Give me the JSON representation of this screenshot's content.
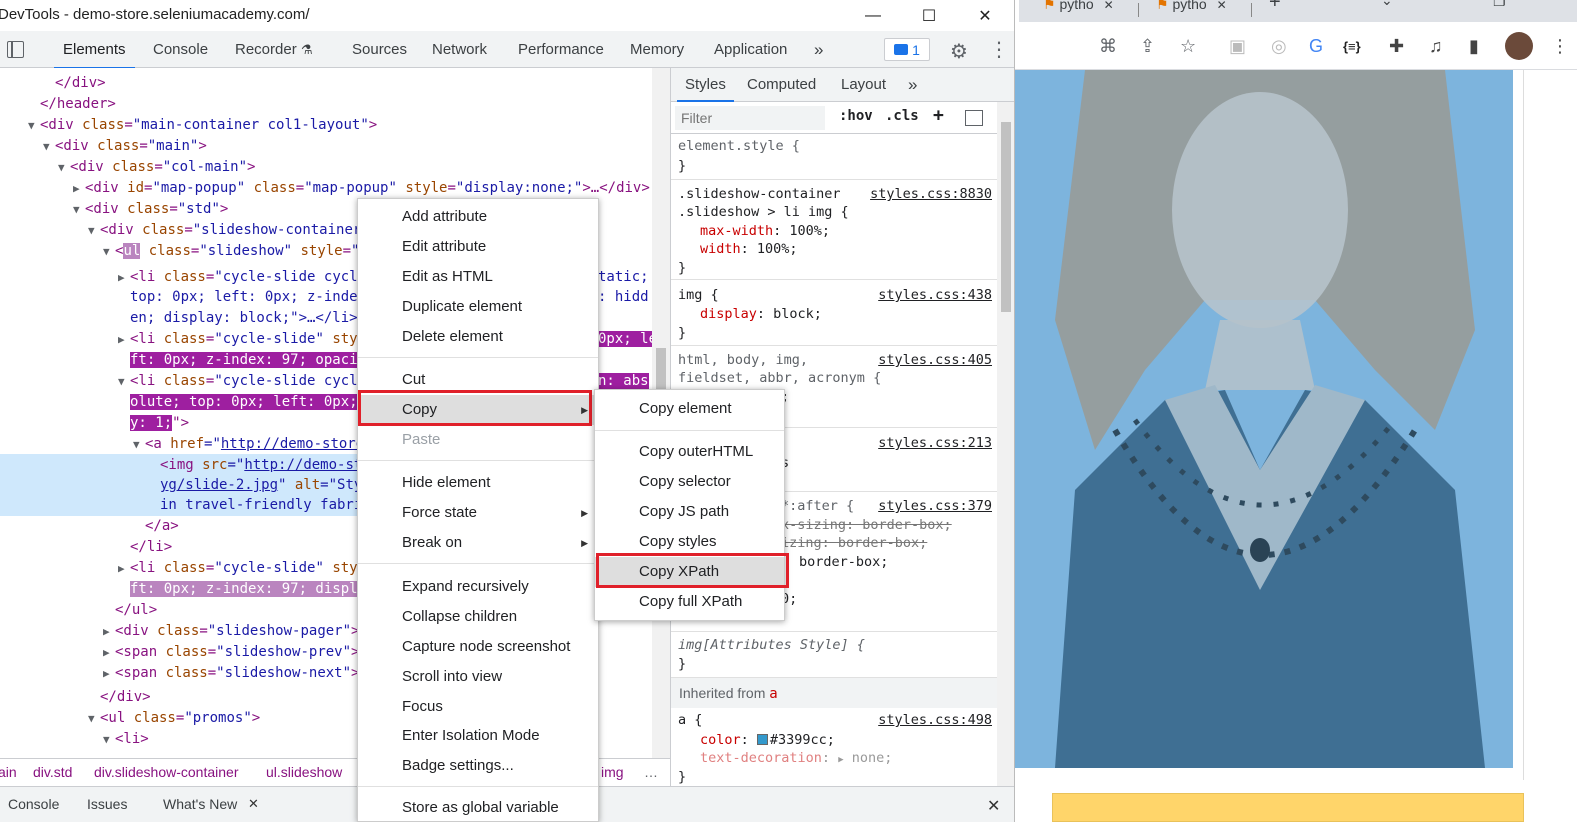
{
  "titlebar": {
    "title": "DevTools - demo-store.seleniumacademy.com/",
    "minimize": "—",
    "maximize": "☐",
    "close": "✕"
  },
  "devtools_tabs": [
    "Elements",
    "Console",
    "Recorder",
    "Sources",
    "Network",
    "Performance",
    "Memory",
    "Application",
    "»"
  ],
  "recorder_glyph": "⚗",
  "issues_count": "1",
  "icons": {
    "settings": "⚙",
    "more": "⋮"
  },
  "dom": {
    "l0": "</div>",
    "l1": "</header>",
    "l2": {
      "tag": "<div ",
      "an": "class",
      "av": "\"main-container col1-layout\"",
      "end": ">"
    },
    "l3": {
      "tag": "<div ",
      "an": "class",
      "av": "\"main\"",
      "end": ">"
    },
    "l4": {
      "tag": "<div ",
      "an": "class",
      "av": "\"col-main\"",
      "end": ">"
    },
    "l5": {
      "tag": "<div ",
      "an": "id",
      "av": "\"map-popup\"",
      "an2": " class",
      "av2": "\"map-popup\"",
      "an3": " style",
      "av3": "\"display:none;\"",
      "end": ">…</div>"
    },
    "l6": {
      "tag": "<div ",
      "an": "class",
      "av": "\"std\"",
      "end": ">"
    },
    "l7": {
      "tag": "<div ",
      "an": "class",
      "av": "\"slideshow-container"
    },
    "l8": {
      "pre": "<",
      "tagname": "ul",
      "an": " class",
      "av": "\"slideshow\"",
      "an2": " style",
      "av2": "\""
    },
    "l9a": {
      "tag": "<li ",
      "an": "class",
      "av": "\"cycle-slide cycle",
      "tail": "tatic;"
    },
    "l9b": {
      "text": "top: 0px; left: 0px; z-index",
      "tail": ": hidd"
    },
    "l9c": {
      "text": "en; display: block;\">…</li>"
    },
    "l10a": {
      "tag": "<li ",
      "an": "class",
      "av": "\"cycle-slide\"",
      "an2": " sty",
      "tail": "0px; le"
    },
    "l10b": {
      "text": "ft: 0px; z-index: 97; opacit"
    },
    "l11a": {
      "tag": "<li ",
      "an": "class",
      "av": "\"cycle-slide cycle",
      "tail": "n: abs"
    },
    "l11b": {
      "text": "olute; top: 0px; left: 0px;"
    },
    "l11c": {
      "text": "y: 1;",
      "end": "\">"
    },
    "l12": {
      "tag": "<a ",
      "an": "href",
      "eq": "=\"",
      "link": "http://demo-store"
    },
    "l13": {
      "tag": "<img ",
      "an": "src",
      "eq": "=\"",
      "link": "http://demo-st"
    },
    "l13b": {
      "link": "yg/slide-2.jpg",
      "rest": "\" ",
      "an": "alt",
      "av": "=\"Sty"
    },
    "l13c": {
      "text": "in travel-friendly fabri"
    },
    "l14": "</a>",
    "l15": "</li>",
    "l16a": {
      "tag": "<li ",
      "an": "class",
      "av": "\"cycle-slide\"",
      "an2": " styl"
    },
    "l16b": {
      "text": "ft: 0px; z-index: 97; displa"
    },
    "l17": "</ul>",
    "l18": {
      "tag": "<div ",
      "an": "class",
      "av": "\"slideshow-pager\"",
      "end": ">…"
    },
    "l19": {
      "tag": "<span ",
      "an": "class",
      "av": "\"slideshow-prev\"",
      "end": ">…"
    },
    "l20": {
      "tag": "<span ",
      "an": "class",
      "av": "\"slideshow-next\"",
      "end": ">…"
    },
    "l21": "</div>",
    "l22": {
      "tag": "<ul ",
      "an": "class",
      "av": "\"promos\"",
      "end": ">"
    },
    "l23": "<li>"
  },
  "breadcrumbs": [
    "ain",
    "div.std",
    "div.slideshow-container",
    "ul.slideshow",
    "img"
  ],
  "breadcrumbs_more": "…",
  "drawer": {
    "tabs": [
      "Console",
      "Issues",
      "What's New"
    ],
    "whatsnew_close": "✕",
    "close": "✕"
  },
  "styles_tabs": [
    "Styles",
    "Computed",
    "Layout",
    "»"
  ],
  "filter_placeholder": "Filter",
  "filter_controls": {
    "hov": ":hov",
    "cls": ".cls",
    "plus": "+"
  },
  "rules": {
    "r0": {
      "sel": "element.style {",
      "close": "}"
    },
    "r1": {
      "sel1": ".slideshow-container",
      "sel2": ".slideshow > li img {",
      "src": "styles.css:8830",
      "p1": "max-width",
      "v1": ": 100%;",
      "p2": "width",
      "v2": ": 100%;",
      "close": "}"
    },
    "r2": {
      "sel": "img {",
      "src": "styles.css:438",
      "p1": "display",
      "v1": ": block;",
      "close": "}"
    },
    "r3": {
      "sel1": "html, body, img,",
      "sel2": "fieldset, abbr, acronym {",
      "src": "styles.css:405",
      "frag": ";"
    },
    "r4": {
      "src": "styles.css:213",
      "frag": "s"
    },
    "r5": {
      "sel": "*:after {",
      "src": "styles.css:379",
      "s1": "x-sizing: border-box;",
      "s2": "izing: border-box;",
      "s3": "border-box;",
      "s4": "0;"
    },
    "r6": {
      "sel": "img[Attributes Style] {",
      "close": "}"
    },
    "inherited": {
      "label": "Inherited from ",
      "el": "a"
    },
    "r7": {
      "sel": "a {",
      "src": "styles.css:498",
      "p1": "color",
      "v1": "#3399cc;",
      "p2": "text-decoration",
      "v2": "none;",
      "close": "}"
    }
  },
  "context_menu": {
    "items": [
      "Add attribute",
      "Edit attribute",
      "Edit as HTML",
      "Duplicate element",
      "Delete element",
      "Cut",
      "Copy",
      "Paste",
      "Hide element",
      "Force state",
      "Break on",
      "Expand recursively",
      "Collapse children",
      "Capture node screenshot",
      "Scroll into view",
      "Focus",
      "Enter Isolation Mode",
      "Badge settings...",
      "Store as global variable"
    ],
    "submenu_arrow": "▶"
  },
  "copy_submenu": [
    "Copy element",
    "Copy outerHTML",
    "Copy selector",
    "Copy JS path",
    "Copy styles",
    "Copy XPath",
    "Copy full XPath"
  ],
  "browser": {
    "tabs": [
      "pytho",
      "pytho"
    ],
    "tab_close": "✕",
    "new_tab": "+",
    "toolbar_icons": [
      "translate-icon",
      "share-icon",
      "star-icon",
      "extension-icon",
      "extension-icon",
      "translate-extension-icon",
      "json-extension-icon",
      "puzzle-icon",
      "media-icon",
      "sidepanel-icon",
      "avatar",
      "more-icon"
    ],
    "json_ext": "{≡}"
  },
  "colors": {
    "accent": "#1a73e8",
    "highlight_red": "#e0202a",
    "selection": "#cfe8fc",
    "swatch": "#3399cc"
  }
}
